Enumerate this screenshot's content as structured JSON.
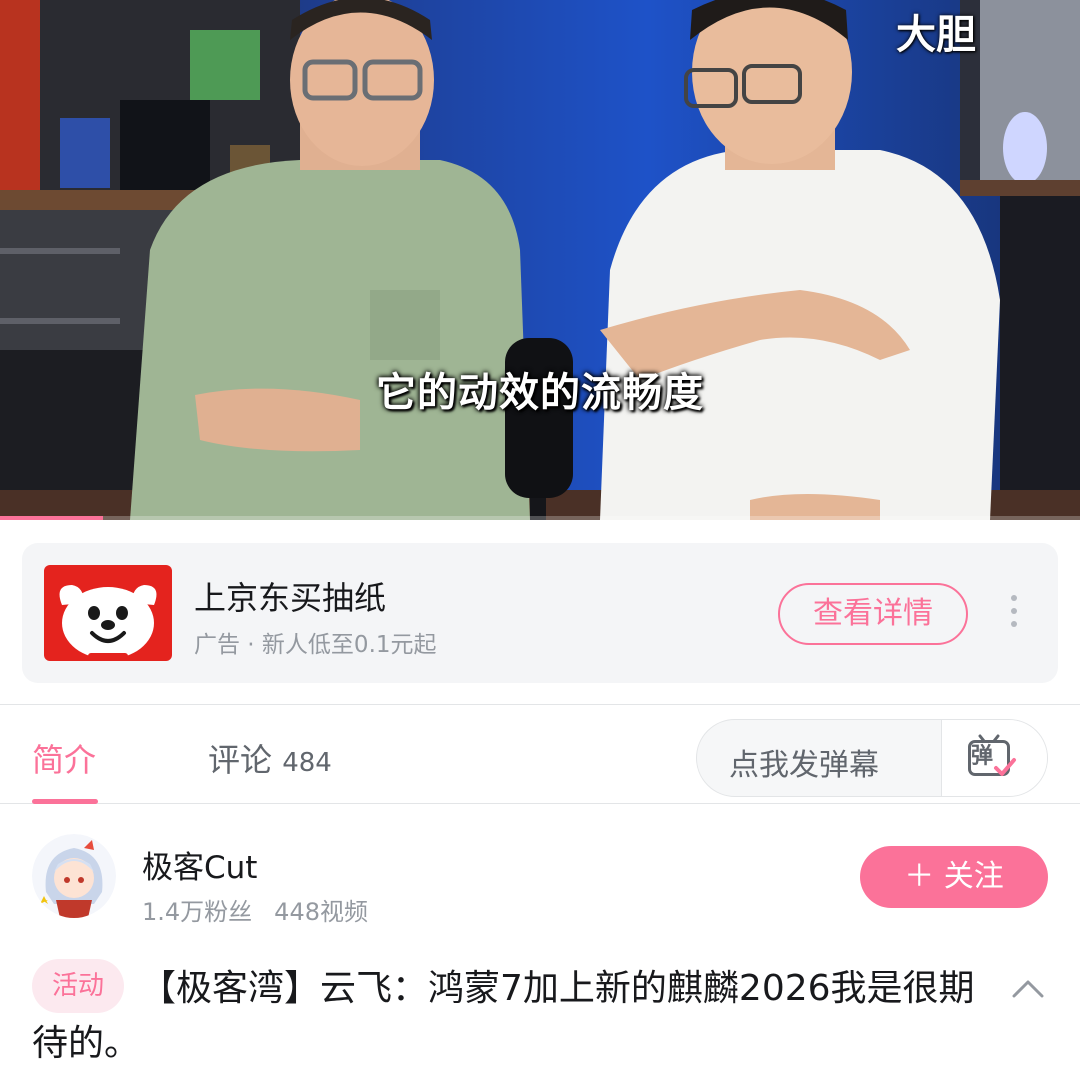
{
  "video": {
    "top_right_caption": "大胆",
    "subtitle": "它的动效的流畅度",
    "progress_fraction": 0.095,
    "progress_color": "#fb7299"
  },
  "ad": {
    "logo_icon": "jd-dog-mascot-icon",
    "title": "上京东买抽纸",
    "subtitle": "广告 · 新人低至0.1元起",
    "cta": "查看详情",
    "more_icon": "more-vertical-icon"
  },
  "tabs": {
    "items": [
      {
        "label": "简介",
        "count": "",
        "active": true
      },
      {
        "label": "评论",
        "count": "484",
        "active": false
      }
    ]
  },
  "danmaku": {
    "placeholder": "点我发弹幕",
    "icon": "danmaku-send-icon",
    "icon_char": "弹"
  },
  "uploader": {
    "name": "极客Cut",
    "fans": "1.4万粉丝",
    "videos": "448视频",
    "follow_label": "＋ 关注"
  },
  "video_info": {
    "tag": "活动",
    "title": "【极客湾】云飞：鸿蒙7加上新的麒麟2026我是很期待的。",
    "collapse_icon": "chevron-up-icon"
  },
  "colors": {
    "accent": "#fb7299",
    "text_primary": "#18191c",
    "text_secondary": "#61666d",
    "text_tertiary": "#9499a0",
    "ad_brand": "#e4231e"
  }
}
